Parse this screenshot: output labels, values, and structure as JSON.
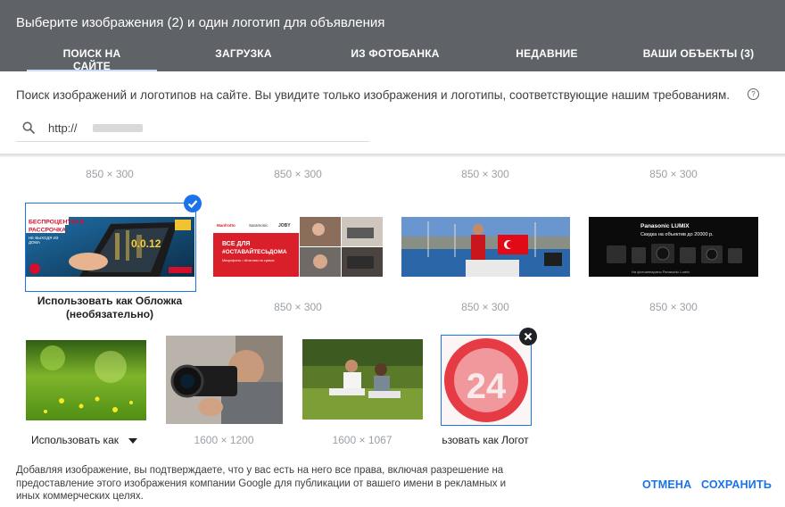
{
  "dialog": {
    "title": "Выберите изображения (2) и один логотип для объявления"
  },
  "tabs": [
    {
      "label": "ПОИСК НА САЙТЕ"
    },
    {
      "label": "ЗАГРУЗКА"
    },
    {
      "label": "ИЗ ФОТОБАНКА"
    },
    {
      "label": "НЕДАВНИЕ"
    },
    {
      "label": "ВАШИ ОБЪЕКТЫ (3)"
    }
  ],
  "search": {
    "description": "Поиск изображений и логотипов на сайте. Вы увидите только изображения и логотипы, соответствующие нашим требованиям.",
    "help_glyph": "?",
    "value": "http://"
  },
  "top_row": {
    "dims": [
      "850 × 300",
      "850 × 300",
      "850 × 300",
      "850 × 300"
    ]
  },
  "row1": {
    "banner1_text": [
      "БЕСПРОЦЕНТНАЯ",
      "РАССРОЧКА",
      "НЕ ВЫХОДЯ ИЗ",
      "ДОМА",
      "0.0.12"
    ],
    "banner2_text": [
      "ВСЕ ДЛЯ",
      "#ОСТАВАЙТЕСЬДОМА",
      "Микрофоны • Штативы на суммы"
    ],
    "banner2_logos": [
      "Manfrotto",
      "Saramonic",
      "JOBY"
    ],
    "banner4_text": [
      "Panasonic LUMIX",
      "Скидка на объектив до 20000 р.",
      "На фотоаппараты Panasonic Lumix"
    ],
    "caption": "Использовать как Обложка\n(необязательно)",
    "dims": [
      "850 × 300",
      "850 × 300",
      "850 × 300"
    ]
  },
  "row2": {
    "dropdown_label": "Использовать как",
    "dims": [
      "1600 × 1200",
      "1600 × 1067"
    ],
    "logo_number": "24",
    "logo_caption": "ьзовать как Логот"
  },
  "footer": {
    "note": "Добавляя изображение, вы подтверждаете, что у вас есть на него все права, включая разрешение на предоставление этого изображения компании Google для публикации от вашего имени в рекламных и иных коммерческих целях.",
    "cancel": "ОТМЕНА",
    "save": "СОХРАНИТЬ"
  },
  "colors": {
    "header": "#5f6368",
    "accent": "#1a73e8",
    "logo_red": "#e30613"
  }
}
